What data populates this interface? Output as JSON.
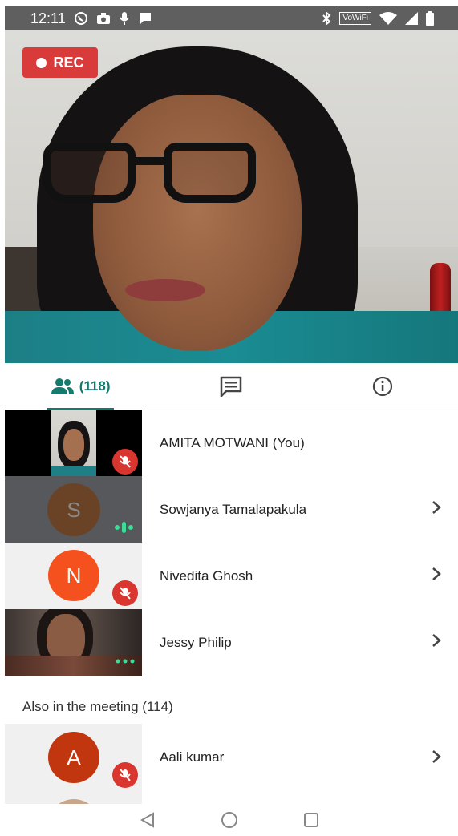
{
  "status_bar": {
    "time": "12:11",
    "wifi_label": "VoWiFi",
    "icons_left": [
      "whatsapp-icon",
      "camera-icon",
      "mic-icon",
      "chat-bubble-icon"
    ],
    "icons_right": [
      "bluetooth-icon",
      "wifi-icon",
      "signal-icon",
      "battery-icon"
    ]
  },
  "recording_badge": {
    "label": "REC"
  },
  "tabs": [
    {
      "name": "people",
      "icon": "people-icon",
      "count": "(118)",
      "active": true
    },
    {
      "name": "chat",
      "icon": "chat-icon",
      "active": false
    },
    {
      "name": "info",
      "icon": "info-icon",
      "active": false
    }
  ],
  "participants": [
    {
      "name": "AMITA MOTWANI (You)",
      "type": "video",
      "muted": true,
      "chevron": false
    },
    {
      "name": "Sowjanya Tamalapakula",
      "type": "avatar",
      "initial": "S",
      "avatar_color": "#6a4326",
      "tile_color": "#56585b",
      "speaking": true,
      "muted": false,
      "chevron": true
    },
    {
      "name": "Nivedita Ghosh",
      "type": "avatar",
      "initial": "N",
      "avatar_color": "#f4511e",
      "tile_color": "#f0f0f0",
      "muted": true,
      "chevron": true
    },
    {
      "name": "Jessy Philip",
      "type": "video",
      "muted": false,
      "more_dots": true,
      "chevron": true
    }
  ],
  "also_in_meeting": {
    "header": "Also in the meeting (114)",
    "items": [
      {
        "name": "Aali kumar",
        "initial": "A",
        "avatar_color": "#c2360f",
        "muted": true,
        "chevron": true
      }
    ]
  },
  "nav_bar": {
    "icons": [
      "back-icon",
      "home-icon",
      "recents-icon"
    ]
  },
  "colors": {
    "accent": "#137a6e",
    "rec_red": "#d93b3b",
    "mute_red": "#d8362e"
  }
}
